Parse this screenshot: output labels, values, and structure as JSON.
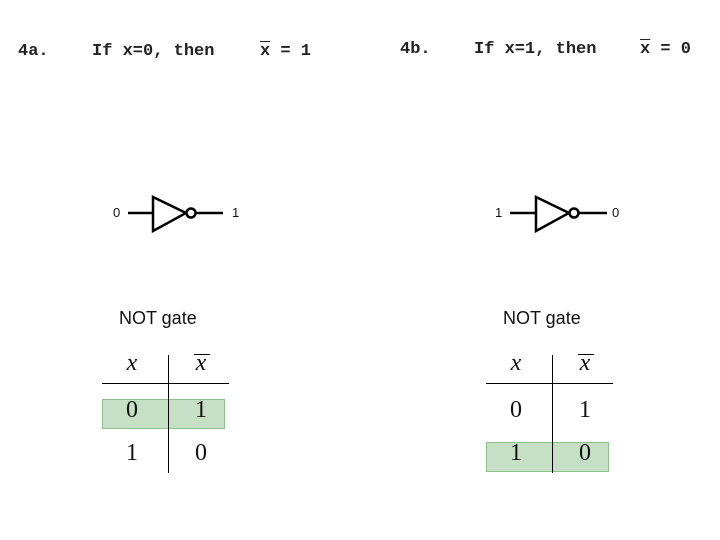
{
  "panels": [
    {
      "id": "4a",
      "number_label": "4a.",
      "condition_text": "If x=0, then",
      "result_var": "x",
      "result_text": " = 1",
      "gate": {
        "input": "0",
        "output": "1"
      },
      "caption": "NOT gate",
      "truth_table": {
        "headers": [
          "x",
          "x"
        ],
        "rows": [
          [
            "0",
            "1"
          ],
          [
            "1",
            "0"
          ]
        ],
        "highlighted_row": 0
      }
    },
    {
      "id": "4b",
      "number_label": "4b.",
      "condition_text": "If x=1, then",
      "result_var": "x",
      "result_text": " = 0",
      "gate": {
        "input": "1",
        "output": "0"
      },
      "caption": "NOT gate",
      "truth_table": {
        "headers": [
          "x",
          "x"
        ],
        "rows": [
          [
            "0",
            "1"
          ],
          [
            "1",
            "0"
          ]
        ],
        "highlighted_row": 1
      }
    }
  ],
  "colors": {
    "highlight": "#c5e0c5",
    "highlight_border": "#8fbf8f"
  }
}
